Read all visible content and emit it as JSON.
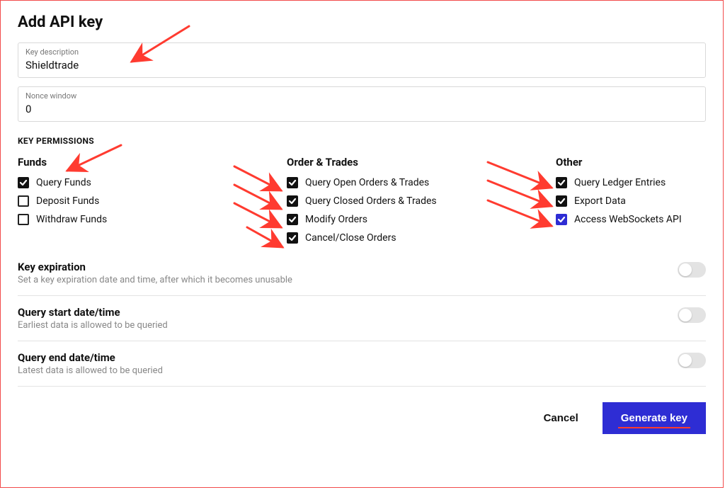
{
  "title": "Add API key",
  "fields": {
    "description": {
      "label": "Key description",
      "value": "Shieldtrade"
    },
    "nonce": {
      "label": "Nonce window",
      "value": "0"
    }
  },
  "permissions_header": "KEY PERMISSIONS",
  "permissions": {
    "funds": {
      "title": "Funds",
      "items": [
        {
          "label": "Query Funds",
          "checked": true
        },
        {
          "label": "Deposit Funds",
          "checked": false
        },
        {
          "label": "Withdraw Funds",
          "checked": false
        }
      ]
    },
    "orders": {
      "title": "Order & Trades",
      "items": [
        {
          "label": "Query Open Orders & Trades",
          "checked": true
        },
        {
          "label": "Query Closed Orders & Trades",
          "checked": true
        },
        {
          "label": "Modify Orders",
          "checked": true
        },
        {
          "label": "Cancel/Close Orders",
          "checked": true
        }
      ]
    },
    "other": {
      "title": "Other",
      "items": [
        {
          "label": "Query Ledger Entries",
          "checked": true
        },
        {
          "label": "Export Data",
          "checked": true
        },
        {
          "label": "Access WebSockets API",
          "checked": true,
          "blue": true
        }
      ]
    }
  },
  "settings": {
    "expiration": {
      "title": "Key expiration",
      "desc": "Set a key expiration date and time, after which it becomes unusable",
      "on": false
    },
    "query_start": {
      "title": "Query start date/time",
      "desc": "Earliest data is allowed to be queried",
      "on": false
    },
    "query_end": {
      "title": "Query end date/time",
      "desc": "Latest data is allowed to be queried",
      "on": false
    }
  },
  "actions": {
    "cancel": "Cancel",
    "generate": "Generate key"
  },
  "annotation_color": "#ff3b30"
}
